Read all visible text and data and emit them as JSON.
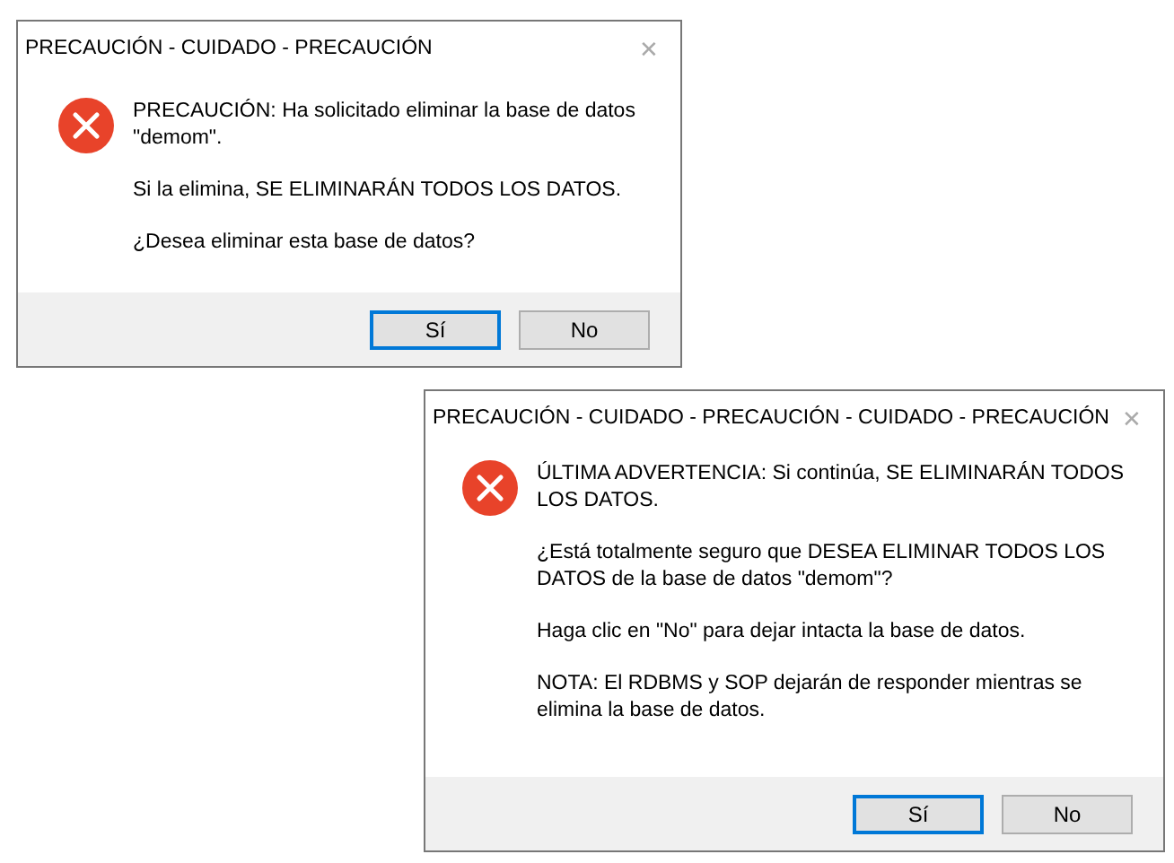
{
  "dialogs": [
    {
      "title": "PRECAUCIÓN - CUIDADO - PRECAUCIÓN",
      "close": "✕",
      "paragraphs": [
        "PRECAUCIÓN: Ha solicitado eliminar la base de datos \"demom\".",
        "Si la elimina, SE ELIMINARÁN TODOS LOS DATOS.",
        "¿Desea eliminar esta base de datos?"
      ],
      "buttons": [
        {
          "label": "Sí",
          "focused": true
        },
        {
          "label": "No",
          "focused": false
        }
      ]
    },
    {
      "title": "PRECAUCIÓN - CUIDADO - PRECAUCIÓN - CUIDADO - PRECAUCIÓN",
      "close": "✕",
      "paragraphs": [
        "ÚLTIMA ADVERTENCIA: Si continúa, SE ELIMINARÁN TODOS LOS DATOS.",
        "¿Está totalmente seguro que DESEA ELIMINAR TODOS LOS DATOS de la base de datos \"demom\"?",
        "Haga clic en \"No\" para dejar intacta la base de datos.",
        "NOTA: El RDBMS y SOP dejarán de responder mientras se elimina la base de datos."
      ],
      "buttons": [
        {
          "label": "Sí",
          "focused": true
        },
        {
          "label": "No",
          "focused": false
        }
      ]
    }
  ]
}
